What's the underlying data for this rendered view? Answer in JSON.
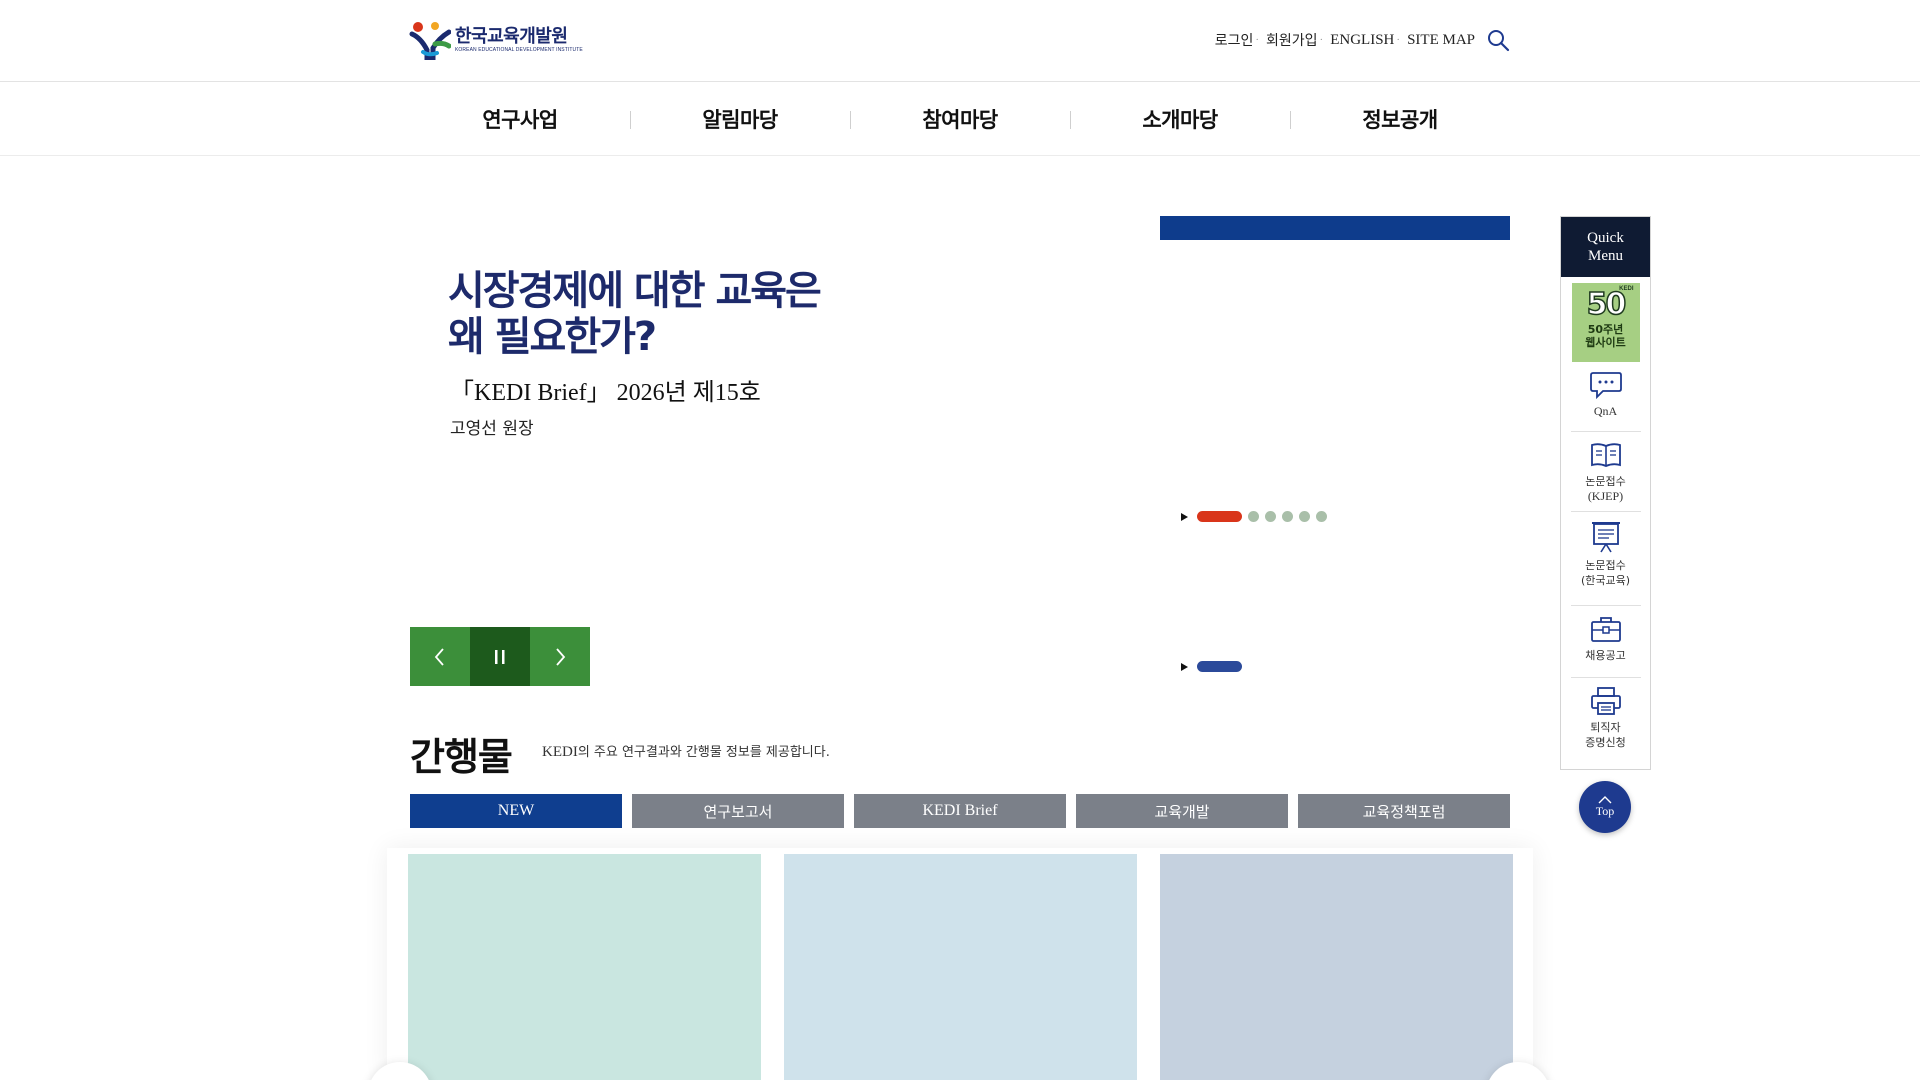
{
  "header": {
    "logo_ko": "한국교육개발원",
    "logo_en": "KOREAN EDUCATIONAL DEVELOPMENT INSTITUTE",
    "util": {
      "login": "로그인",
      "join": "회원가입",
      "english": "ENGLISH",
      "sitemap": "SITE MAP",
      "sep": "·"
    }
  },
  "gnb": {
    "items": [
      "연구사업",
      "알림마당",
      "참여마당",
      "소개마당",
      "정보공개"
    ]
  },
  "hero": {
    "title_line1": "시장경제에 대한 교육은",
    "title_line2": "왜 필요한가?",
    "subtitle": "「KEDI Brief」 2026년 제15호",
    "author": "고영선 원장"
  },
  "colors": {
    "navy": "#1d2a6b",
    "tab_active": "#0f3e8f",
    "tab_inactive": "#7b8089",
    "ctrl_green": "#3c8f3a",
    "ctrl_dark_green": "#1d5a1c",
    "pager_red": "#d9351a",
    "pager_blue": "#2b4a9a"
  },
  "pager1": {
    "active_index": 0,
    "count": 6
  },
  "pager2": {
    "active_index": 0,
    "count": 1
  },
  "publications": {
    "title": "간행물",
    "desc_prefix": "KEDI",
    "desc_rest": "의 주요 연구결과와 간행물 정보를 제공합니다.",
    "tabs": [
      "NEW",
      "연구보고서",
      "KEDI Brief",
      "교육개발",
      "교육정책포럼"
    ],
    "active_tab": 0
  },
  "quick_menu": {
    "title_line1": "Quick",
    "title_line2": "Menu",
    "anniv_brand": "KEDI",
    "anniv_num": "50",
    "anniv_line1": "50주년",
    "anniv_line2": "웹사이트",
    "items": [
      {
        "icon": "chat-icon",
        "line1": "QnA",
        "line2": ""
      },
      {
        "icon": "book-icon",
        "line1": "논문접수",
        "line2": "(KJEP)"
      },
      {
        "icon": "presentation-board-icon",
        "line1": "논문접수",
        "line2": "(한국교육)"
      },
      {
        "icon": "briefcase-icon",
        "line1": "채용공고",
        "line2": ""
      },
      {
        "icon": "printer-icon",
        "line1": "퇴직자",
        "line2": "증명신청"
      }
    ]
  },
  "top_button": {
    "label": "Top"
  }
}
